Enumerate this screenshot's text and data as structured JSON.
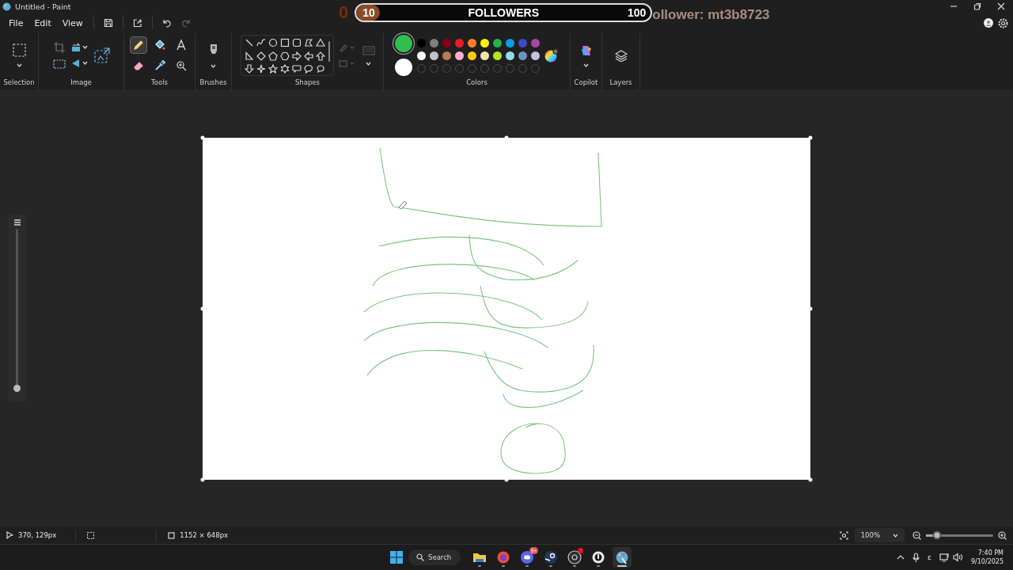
{
  "window": {
    "title": "Untitled - Paint"
  },
  "overlay": {
    "count": "0",
    "current": "10",
    "label": "FOLLOWERS",
    "goal": "100",
    "level": 0.08,
    "ticker": "ollower: mt3b8723"
  },
  "menu": [
    "File",
    "Edit",
    "View"
  ],
  "ribbon": {
    "groups": [
      "Selection",
      "Image",
      "Tools",
      "Brushes",
      "Shapes",
      "Colors",
      "Copilot",
      "Layers"
    ]
  },
  "tools": [
    {
      "kind": "pencil",
      "selected": true
    },
    {
      "kind": "fill",
      "selected": false
    },
    {
      "kind": "text",
      "selected": false
    },
    {
      "kind": "eraser",
      "selected": false
    },
    {
      "kind": "picker",
      "selected": false
    },
    {
      "kind": "magnifier",
      "selected": false
    }
  ],
  "colors": {
    "primary": {
      "color": "#2fbf4f",
      "selected": true
    },
    "secondary": {
      "color": "#ffffff",
      "selected": false
    },
    "palette": [
      {
        "kind": "color",
        "color": "#000000"
      },
      {
        "kind": "color",
        "color": "#7f7f7f"
      },
      {
        "kind": "color",
        "color": "#880015"
      },
      {
        "kind": "color",
        "color": "#ed1c24"
      },
      {
        "kind": "color",
        "color": "#ff7f27"
      },
      {
        "kind": "color",
        "color": "#fff200"
      },
      {
        "kind": "color",
        "color": "#22b14c"
      },
      {
        "kind": "color",
        "color": "#00a2e8"
      },
      {
        "kind": "color",
        "color": "#3f48cc"
      },
      {
        "kind": "color",
        "color": "#a349a4"
      },
      {
        "kind": "color",
        "color": "#ffffff"
      },
      {
        "kind": "color",
        "color": "#c3c3c3"
      },
      {
        "kind": "color",
        "color": "#b97a57"
      },
      {
        "kind": "color",
        "color": "#ffaec9"
      },
      {
        "kind": "color",
        "color": "#ffc90e"
      },
      {
        "kind": "color",
        "color": "#efe4b0"
      },
      {
        "kind": "color",
        "color": "#b5e61d"
      },
      {
        "kind": "color",
        "color": "#99d9ea"
      },
      {
        "kind": "color",
        "color": "#7092be"
      },
      {
        "kind": "color",
        "color": "#c8bfe7"
      },
      {
        "kind": "empty"
      },
      {
        "kind": "empty"
      },
      {
        "kind": "empty"
      },
      {
        "kind": "empty"
      },
      {
        "kind": "empty"
      },
      {
        "kind": "empty"
      },
      {
        "kind": "empty"
      },
      {
        "kind": "empty"
      },
      {
        "kind": "empty"
      },
      {
        "kind": "empty"
      }
    ]
  },
  "brush_size": {
    "level": 0
  },
  "status": {
    "cursor": "370, 129px",
    "canvas_size": "1152 × 648px",
    "zoom": "100%",
    "zoom_slider": {
      "level": 0.16
    }
  },
  "taskbar": {
    "search": "Search",
    "apps": [
      {
        "kind": "folder",
        "active": false,
        "alert": false
      },
      {
        "kind": "browser",
        "active": false,
        "alert": false
      },
      {
        "kind": "chat",
        "active": false,
        "alert": false,
        "badge": "9+"
      },
      {
        "kind": "game-store",
        "active": false,
        "alert": false
      },
      {
        "kind": "recorder",
        "active": false,
        "alert": true
      },
      {
        "kind": "game",
        "active": false,
        "alert": false
      },
      {
        "kind": "paint",
        "active": true,
        "alert": false
      }
    ],
    "tray": {
      "input": "ε",
      "time": "7:40 PM",
      "date": "9/10/2025"
    }
  }
}
